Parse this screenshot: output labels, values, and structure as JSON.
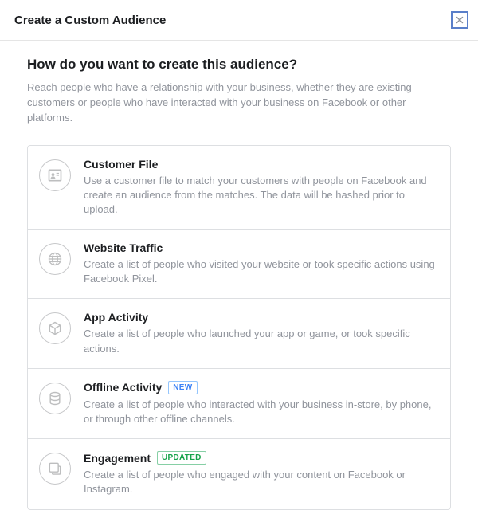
{
  "header": {
    "title": "Create a Custom Audience"
  },
  "question": "How do you want to create this audience?",
  "subtext": "Reach people who have a relationship with your business, whether they are existing customers or people who have interacted with your business on Facebook or other platforms.",
  "options": {
    "customer_file": {
      "title": "Customer File",
      "desc": "Use a customer file to match your customers with people on Facebook and create an audience from the matches. The data will be hashed prior to upload."
    },
    "website_traffic": {
      "title": "Website Traffic",
      "desc": "Create a list of people who visited your website or took specific actions using Facebook Pixel."
    },
    "app_activity": {
      "title": "App Activity",
      "desc": "Create a list of people who launched your app or game, or took specific actions."
    },
    "offline_activity": {
      "title": "Offline Activity",
      "badge": "NEW",
      "desc": "Create a list of people who interacted with your business in-store, by phone, or through other offline channels."
    },
    "engagement": {
      "title": "Engagement",
      "badge": "UPDATED",
      "desc": "Create a list of people who engaged with your content on Facebook or Instagram."
    }
  }
}
